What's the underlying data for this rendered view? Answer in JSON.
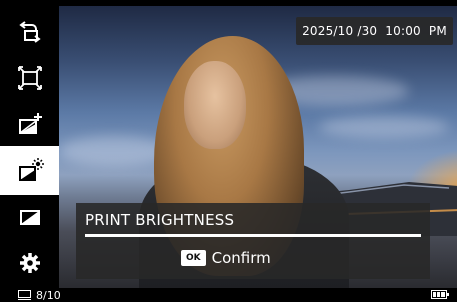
{
  "sidebar": {
    "items": [
      {
        "name": "rotate-icon"
      },
      {
        "name": "crop-icon"
      },
      {
        "name": "add-frame-icon"
      },
      {
        "name": "brightness-icon",
        "active": true
      },
      {
        "name": "filter-icon"
      },
      {
        "name": "settings-gear-icon"
      }
    ]
  },
  "photo": {
    "date_time": "2025/10 /30  10:00  PM"
  },
  "dialog": {
    "title": "PRINT BRIGHTNESS",
    "ok_key": "OK",
    "confirm_label": "Confirm"
  },
  "status": {
    "image_counter": "8/10",
    "battery": "full"
  },
  "colors": {
    "sidebar_bg": "#000000",
    "active_bg": "#ffffff",
    "overlay_bg": "#282828"
  }
}
